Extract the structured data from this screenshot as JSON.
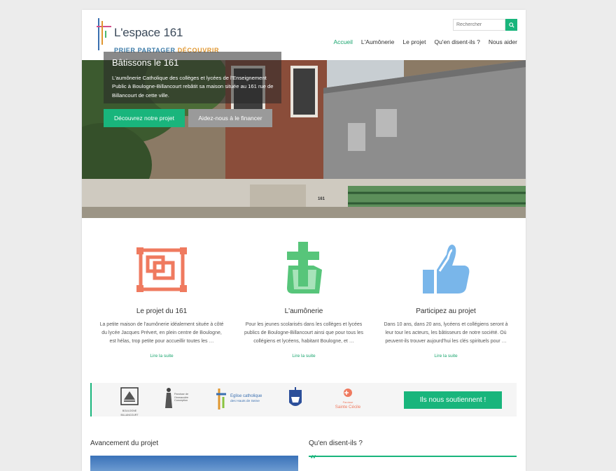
{
  "header": {
    "logo_title": "L'espace 161",
    "logo_tag_a": "PRIER PARTAGER",
    "logo_tag_b": "DÉCOUVRIR",
    "search_placeholder": "Rechercher"
  },
  "nav": [
    {
      "label": "Accueil",
      "active": true
    },
    {
      "label": "L'Aumônerie"
    },
    {
      "label": "Le projet"
    },
    {
      "label": "Qu'en disent-ils ?"
    },
    {
      "label": "Nous aider"
    }
  ],
  "hero": {
    "title": "Bâtissons le 161",
    "text": "L'aumônerie Catholique des collèges et lycées de l'Enseignement Public à Boulogne-Billancourt rebâtit sa maison située au 161 rue de Billancourt de cette ville.",
    "button_primary": "Découvrez notre projet",
    "button_secondary": "Aidez-nous à le financer",
    "house_number": "161"
  },
  "features": [
    {
      "title": "Le projet du 161",
      "text": "La petite maison de l'aumônerie idéalement située à côté du lycée Jacques Prévert, en plein centre de Boulogne, est hélas, trop petite pour accueillir toutes les …",
      "more": "Lire la suite",
      "icon": "blueprint-icon"
    },
    {
      "title": "L'aumônerie",
      "text": "Pour les jeunes scolarisés dans les collèges et lycées publics de Boulogne-Billancourt ainsi que pour tous les collégiens et lycéens, habitant Boulogne, et …",
      "more": "Lire la suite",
      "icon": "cross-book-icon"
    },
    {
      "title": "Participez au projet",
      "text": "Dans 10 ans, dans 20 ans, lycéens et collégiens seront à leur tour les acteurs, les bâtisseurs de notre société. Où peuvent-ils trouver aujourd'hui les clés spirituels pour …",
      "more": "Lire la suite",
      "icon": "thumbs-up-icon"
    }
  ],
  "partners": {
    "boulogne": "BOULOGNE BILLANCOURT",
    "paroisse_a": "Paroisse de l'Immaculée Conception",
    "eglise_a": "Eglise catholique",
    "eglise_b": "des Hauts de Seine",
    "cecile_a": "Paroisse",
    "cecile_b": "Sainte Cécile",
    "button": "Ils nous soutiennent !"
  },
  "sections": {
    "progress_title": "Avancement du projet",
    "quotes_title": "Qu'en disent-ils ?"
  },
  "colors": {
    "accent": "#19b57c",
    "blueprint": "#ef7a5f",
    "cross": "#57c57a",
    "thumb": "#79b6ea"
  }
}
